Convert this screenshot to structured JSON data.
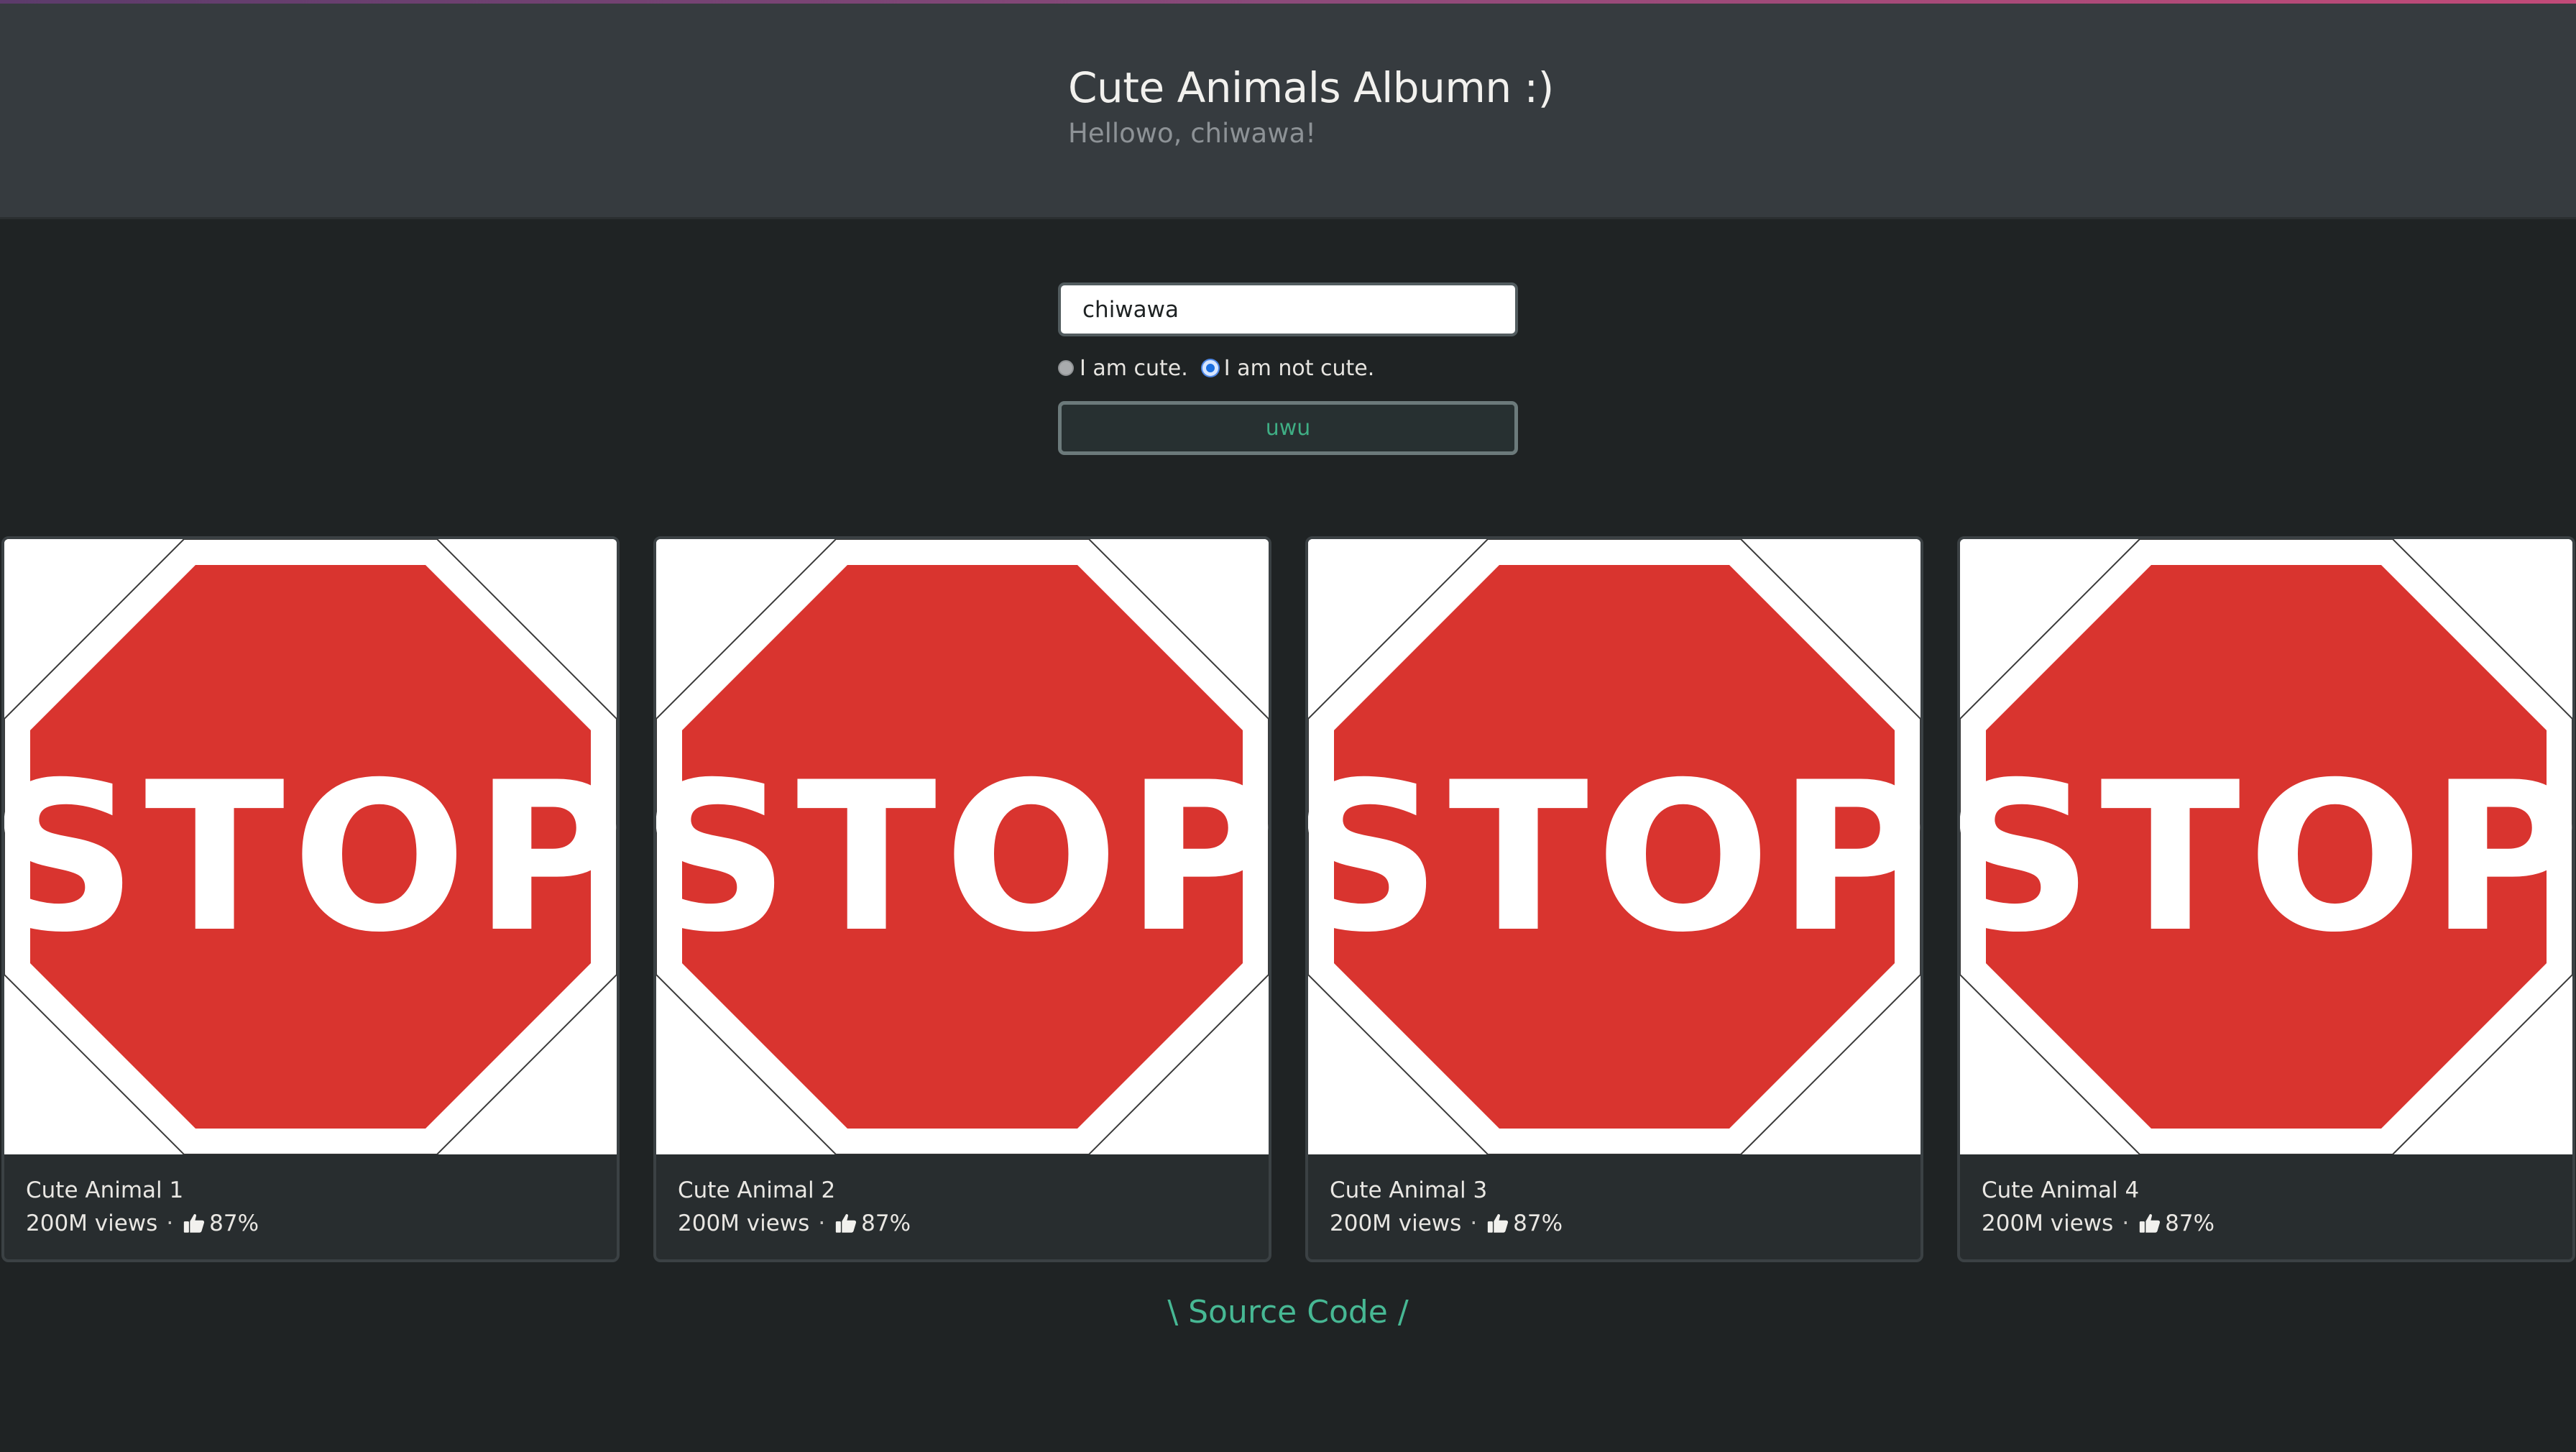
{
  "header": {
    "title": "Cute Animals Albumn :)",
    "subtitle": "Hellowo, chiwawa!"
  },
  "form": {
    "name_value": "chiwawa",
    "radios": [
      {
        "label": "I am cute.",
        "checked": false
      },
      {
        "label": "I am not cute.",
        "checked": true
      }
    ],
    "submit_label": "uwu"
  },
  "cards": [
    {
      "title": "Cute Animal 1",
      "views": "200M views",
      "separator": "·",
      "likes": "87%",
      "image": "stop-sign",
      "image_text": "STOP"
    },
    {
      "title": "Cute Animal 2",
      "views": "200M views",
      "separator": "·",
      "likes": "87%",
      "image": "stop-sign",
      "image_text": "STOP"
    },
    {
      "title": "Cute Animal 3",
      "views": "200M views",
      "separator": "·",
      "likes": "87%",
      "image": "stop-sign",
      "image_text": "STOP"
    },
    {
      "title": "Cute Animal 4",
      "views": "200M views",
      "separator": "·",
      "likes": "87%",
      "image": "stop-sign",
      "image_text": "STOP"
    }
  ],
  "footer": {
    "source_label": "\\ Source Code /"
  },
  "colors": {
    "header_bg": "#363b3f",
    "page_bg": "#1f2324",
    "accent_green": "#47b894",
    "stop_red": "#d9342f"
  },
  "icons": {
    "likes": "thumbs-up-icon"
  }
}
